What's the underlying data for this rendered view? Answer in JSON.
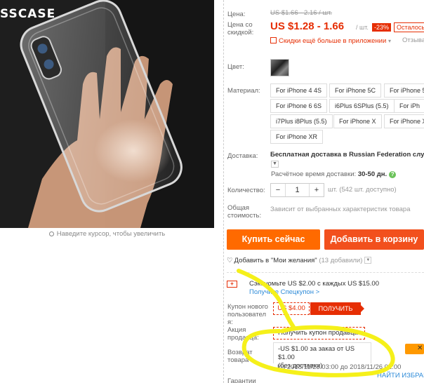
{
  "product_image": {
    "brand": "SSCASE",
    "zoom_hint": "Наведите курсор, чтобы увеличить"
  },
  "price": {
    "label": "Цена:",
    "old": "US $1.66 - 2.16 / шт.",
    "discount_label": "Цена со скидкой:",
    "current": "US $1.28 - 1.66",
    "unit": "/ шт.",
    "discount_badge": "-23%",
    "remaining": "Осталось",
    "app_promo": "Скидки ещё больше в приложении",
    "reviews": "Отзыва"
  },
  "color": {
    "label": "Цвет:"
  },
  "material": {
    "label": "Материал:",
    "options": [
      "For iPhone 4 4S",
      "For iPhone 5C",
      "For iPhone 5",
      "For iPhone 6 6S",
      "i6Plus 6SPlus (5.5)",
      "For iPh",
      "i7Plus i8Plus (5.5)",
      "For iPhone X",
      "For iPhone X",
      "For iPhone XR"
    ]
  },
  "shipping": {
    "label": "Доставка:",
    "text": "Бесплатная доставка в Russian Federation служб",
    "time_label": "Расчётное время доставки:",
    "time_value": "30-50 дн.",
    "help": "?"
  },
  "quantity": {
    "label": "Количество:",
    "minus": "−",
    "value": "1",
    "plus": "+",
    "stock": "шт. (542 шт. доступно)"
  },
  "total": {
    "label_line1": "Общая",
    "label_line2": "стоимость:",
    "text": "Зависит от выбранных характеристик товара"
  },
  "actions": {
    "buy_now": "Купить сейчас",
    "add_to_cart": "Добавить в корзину"
  },
  "wishlist": {
    "text": "Добавить в \"Мои желания\"",
    "count": "(13 добавили)"
  },
  "promo": {
    "icon_label": "+",
    "save_text": "Сэкономьте US $2.00 с каждых US $15.00",
    "save_link": "Получите Спецкупон >"
  },
  "new_user_coupon": {
    "label_lines": [
      "Купон нового",
      "пользовател",
      "я:"
    ],
    "value": "US $4.00",
    "button": "ПОЛУЧИТЬ"
  },
  "seller_promo": {
    "label_lines": [
      "Акция",
      "продавца:"
    ],
    "dropdown": "Получить купон продавца",
    "coupon_line1": "-US $1.00 за заказ от US $1.00",
    "coupon_line2": "(без доставки)",
    "dates": "Из 2018/11/23 03:00 до 2018/11/26 01:00",
    "find_link": "НАЙТИ ИЗБРАН"
  },
  "returns": {
    "label_lines": [
      "Возврат",
      "товара"
    ]
  },
  "guarantees": {
    "label": "Гарантии"
  },
  "colors": {
    "accent_red": "#e62e04",
    "buy_orange": "#ff6a00",
    "cart_orange": "#f2501d",
    "link_blue": "#2e8bd8",
    "highlight_yellow": "#f5f01a"
  }
}
